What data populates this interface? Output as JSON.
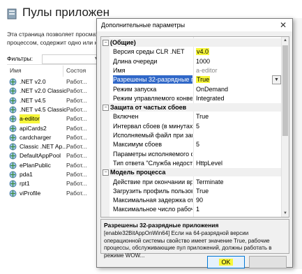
{
  "background": {
    "title": "Пулы приложен",
    "description": [
      "Эта страница позволяет просматр",
      "процессом, содержит одно или н"
    ],
    "filter_label": "Фильтры:",
    "columns": [
      "Имя",
      "Состоя"
    ],
    "right_partial": [
      "Идентиф",
      "Applicat",
      "Applicat",
      "Applicat",
      "Applicat",
      "Applicat",
      "Applicat",
      "Applicat",
      "Applicat",
      "Applicat",
      "Applicat",
      "Applicat"
    ],
    "pools": [
      {
        "name": ".NET v2.0",
        "status": "Работ..."
      },
      {
        "name": ".NET v2.0 Classic",
        "status": "Работ..."
      },
      {
        "name": ".NET v4.5",
        "status": "Работ..."
      },
      {
        "name": ".NET v4.5 Classic",
        "status": "Работ..."
      },
      {
        "name": "a-editor",
        "status": "Работ..."
      },
      {
        "name": "apiCards2",
        "status": "Работ..."
      },
      {
        "name": "cardcharger",
        "status": "Работ..."
      },
      {
        "name": "Classic .NET Ap...",
        "status": "Работ..."
      },
      {
        "name": "DefaultAppPool",
        "status": "Работ..."
      },
      {
        "name": "ePlanPublic",
        "status": "Работ..."
      },
      {
        "name": "pda1",
        "status": "Работ..."
      },
      {
        "name": "rpt1",
        "status": "Работ..."
      },
      {
        "name": "viProfile",
        "status": "Работ..."
      }
    ]
  },
  "dialog": {
    "title": "Дополнительные параметры",
    "close": "✕",
    "rows": [
      {
        "type": "cat",
        "name": "(Общие)",
        "exp": "−"
      },
      {
        "name": "Версия среды CLR .NET",
        "value": "v4.0",
        "hl": true
      },
      {
        "name": "Длина очереди",
        "value": "1000"
      },
      {
        "name": "Имя",
        "value": "a-editor",
        "gray": true
      },
      {
        "name": "Разрешены 32-разрядные при",
        "value": "True",
        "hl": true,
        "selected": true
      },
      {
        "name": "Режим запуска",
        "value": "OnDemand"
      },
      {
        "name": "Режим управляемого конвейе",
        "value": "Integrated"
      },
      {
        "type": "cat",
        "name": "Защита от частых сбоев",
        "exp": "−"
      },
      {
        "name": "Включен",
        "value": "True"
      },
      {
        "name": "Интервал сбоев (в минутах)",
        "value": "5"
      },
      {
        "name": "Исполняемый файл при завер",
        "value": ""
      },
      {
        "name": "Максимум сбоев",
        "value": "5"
      },
      {
        "name": "Параметры исполняемого фай",
        "value": ""
      },
      {
        "name": "Тип ответа \"Служба недоступн",
        "value": "HttpLevel"
      },
      {
        "type": "cat",
        "name": "Модель процесса",
        "exp": "−"
      },
      {
        "name": "Действие при окончании врем",
        "value": "Terminate"
      },
      {
        "name": "Загрузить профиль пользоват",
        "value": "True"
      },
      {
        "name": "Максимальная задержка откл",
        "value": "90"
      },
      {
        "name": "Максимальное число рабочих",
        "value": "1"
      }
    ],
    "desc_title": "Разрешены 32-разрядные приложения",
    "desc_body": "[enable32BitAppOnWin64] Если на 64-разрядной версии операционной системы свойство имеет значение True, рабочие процессы, обслуживающие пул приложений, должны работать в режиме WOW...",
    "ok": "OK",
    "cancel": ""
  }
}
